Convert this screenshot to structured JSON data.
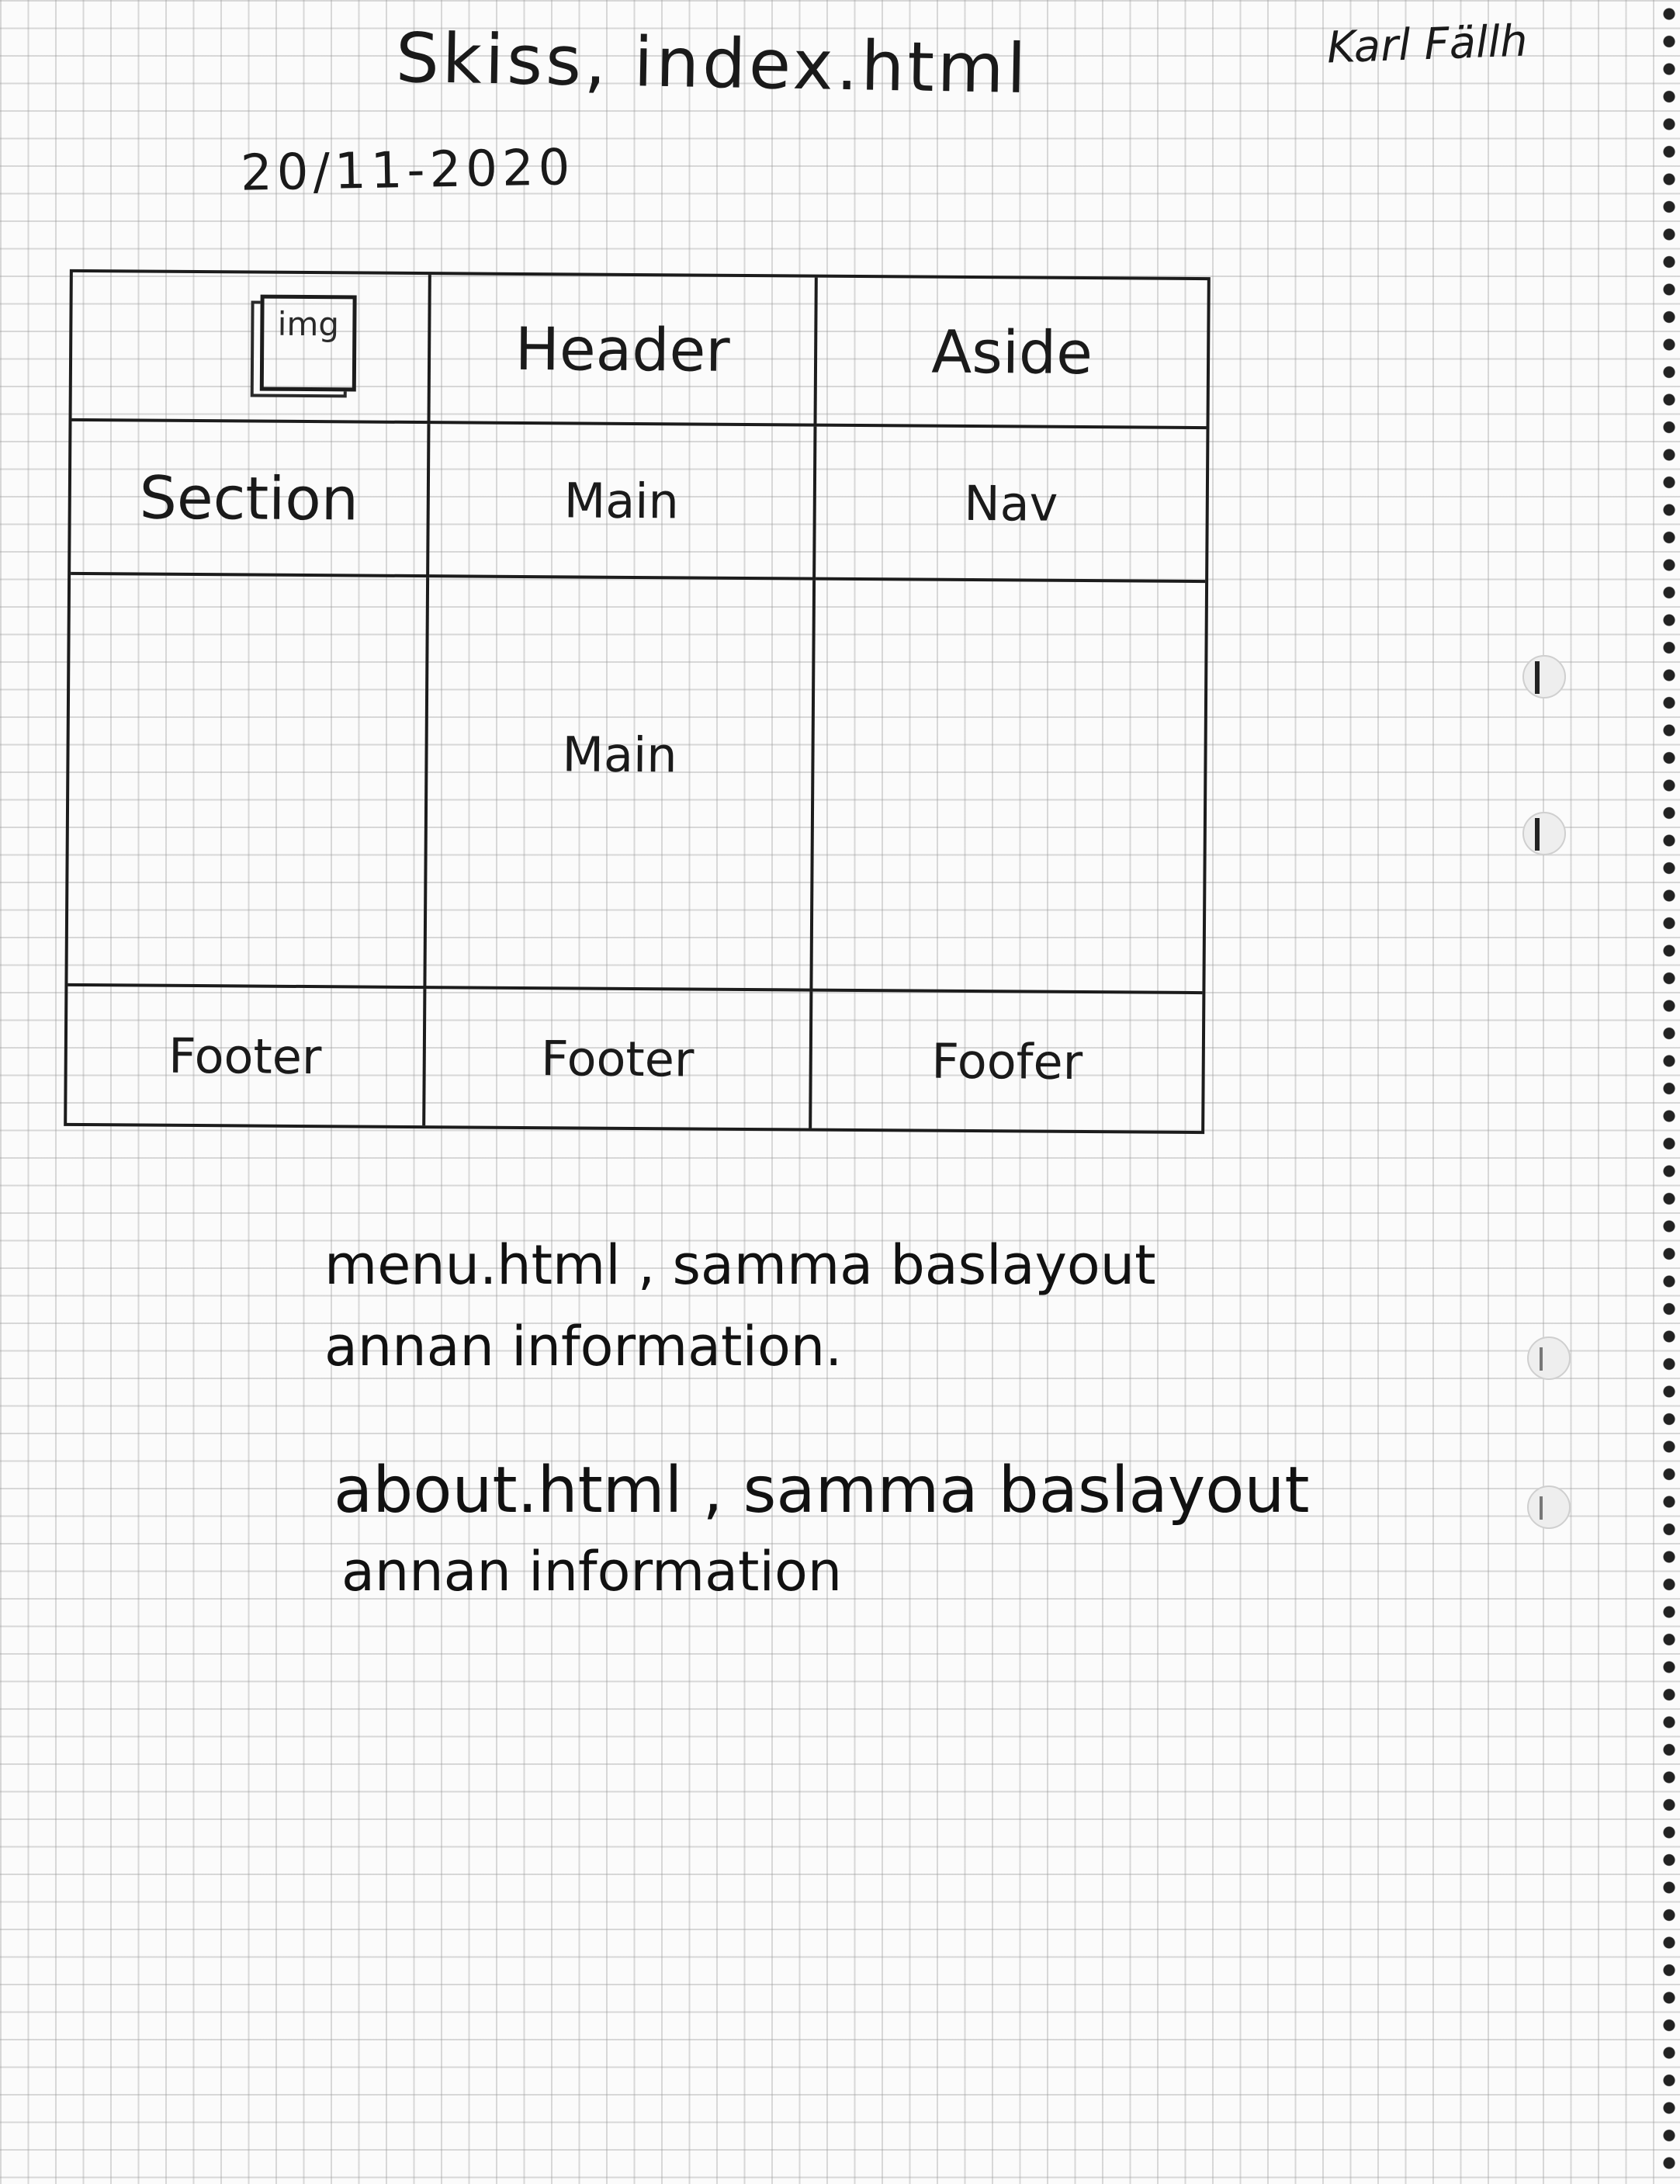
{
  "header": {
    "title": "Skiss, index.html",
    "date": "20/11-2020",
    "signature": "Karl Fällh"
  },
  "sketch": {
    "cells": {
      "img_label": "img",
      "header": "Header",
      "aside": "Aside",
      "section": "Section",
      "main_top": "Main",
      "nav": "Nav",
      "main": "Main",
      "footer_left": "Footer",
      "footer_middle": "Footer",
      "footer_right": "Foofer"
    }
  },
  "notes": {
    "menu_line1": "menu.html , samma baslayout",
    "menu_line2": "annan information.",
    "about_line1": "about.html , samma baslayout",
    "about_line2": "annan information"
  }
}
